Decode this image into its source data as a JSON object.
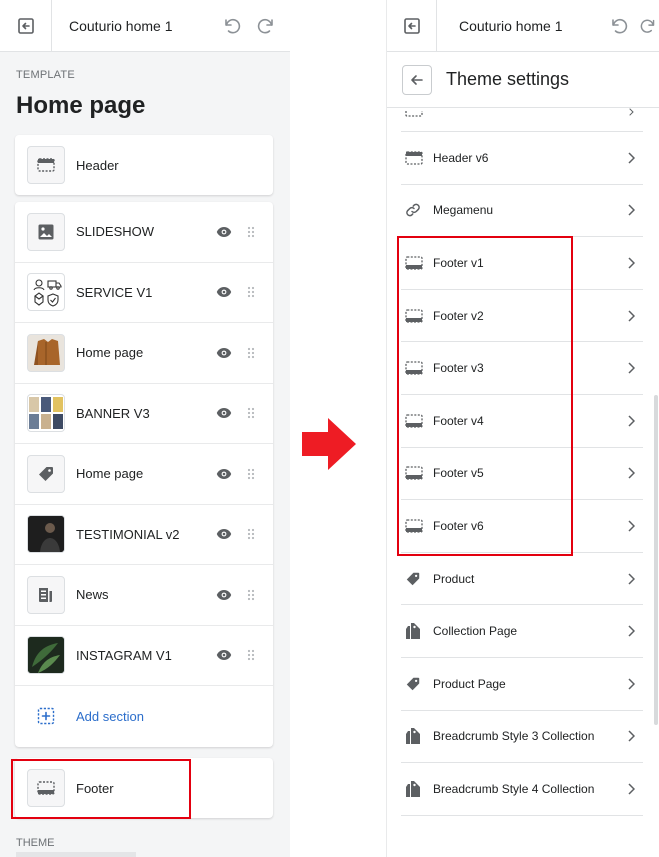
{
  "left_panel": {
    "topbar": {
      "title": "Couturio home 1"
    },
    "template_label": "TEMPLATE",
    "page_title": "Home page",
    "header_item": {
      "label": "Header",
      "icon": "header-layout-icon"
    },
    "sections": [
      {
        "label": "SLIDESHOW",
        "thumb": "image-icon"
      },
      {
        "label": "SERVICE V1",
        "thumb": "service-thumbnail"
      },
      {
        "label": "Home page",
        "thumb": "jacket-thumbnail"
      },
      {
        "label": "BANNER V3",
        "thumb": "banner-thumbnail"
      },
      {
        "label": "Home page",
        "thumb": "tag-icon"
      },
      {
        "label": "TESTIMONIAL v2",
        "thumb": "testimonial-thumbnail"
      },
      {
        "label": "News",
        "thumb": "blog-icon"
      },
      {
        "label": "INSTAGRAM V1",
        "thumb": "plant-thumbnail"
      }
    ],
    "add_section_label": "Add section",
    "footer_item": {
      "label": "Footer",
      "icon": "footer-layout-icon"
    },
    "theme_label": "THEME"
  },
  "right_panel": {
    "topbar": {
      "title": "Couturio home 1"
    },
    "header_title": "Theme settings",
    "items": [
      {
        "label": "Header v6",
        "icon": "header-layout-icon"
      },
      {
        "label": "Megamenu",
        "icon": "link-icon"
      },
      {
        "label": "Footer v1",
        "icon": "footer-layout-icon"
      },
      {
        "label": "Footer v2",
        "icon": "footer-layout-icon"
      },
      {
        "label": "Footer v3",
        "icon": "footer-layout-icon"
      },
      {
        "label": "Footer v4",
        "icon": "footer-layout-icon"
      },
      {
        "label": "Footer v5",
        "icon": "footer-layout-icon"
      },
      {
        "label": "Footer v6",
        "icon": "footer-layout-icon"
      },
      {
        "label": "Product",
        "icon": "tag-icon"
      },
      {
        "label": "Collection Page",
        "icon": "collection-icon"
      },
      {
        "label": "Product Page",
        "icon": "tag-icon"
      },
      {
        "label": "Breadcrumb Style 3 Collection",
        "icon": "collection-icon"
      },
      {
        "label": "Breadcrumb Style 4 Collection",
        "icon": "collection-icon"
      }
    ]
  },
  "colors": {
    "highlight": "#e3000f",
    "link_blue": "#2c6ecb",
    "panel_bg": "#f4f5f6"
  }
}
